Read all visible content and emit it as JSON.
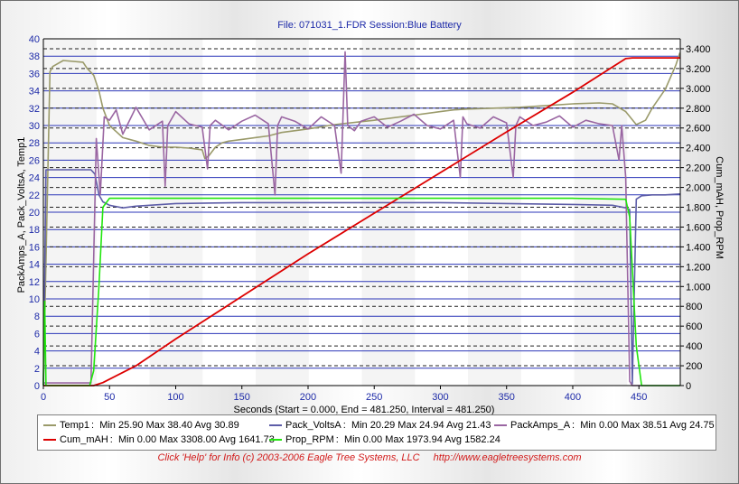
{
  "title": "File: 071031_1.FDR   Session:Blue Battery",
  "footer": {
    "help": "Click 'Help' for Info  (c) 2003-2006 Eagle Tree Systems, LLC",
    "url": "http://www.eagletreesystems.com"
  },
  "chart_data": {
    "type": "line",
    "xlabel": "Seconds (Start = 0.000,  End = 481.250,  Interval =  481.250)",
    "ylabel_left": "PackAmps_A, Pack_VoltsA, Temp1",
    "ylabel_right": "Cum_mAH, Prop_RPM",
    "xlim": [
      0,
      481.25
    ],
    "ylim_left": [
      0,
      40
    ],
    "ylim_right": [
      0,
      3500
    ],
    "xticks": [
      0,
      50,
      100,
      150,
      200,
      250,
      300,
      350,
      400,
      450
    ],
    "yticks_left": [
      0,
      2,
      4,
      6,
      8,
      10,
      12,
      14,
      16,
      18,
      20,
      22,
      24,
      26,
      28,
      30,
      32,
      34,
      36,
      38,
      40
    ],
    "yticks_right": [
      "0",
      "200",
      "400",
      "600",
      "800",
      "1.000",
      "1.200",
      "1.400",
      "1.600",
      "1.800",
      "2.000",
      "2.200",
      "2.400",
      "2.600",
      "2.800",
      "3.000",
      "3.200",
      "3.400"
    ],
    "yticks_right_values": [
      0,
      200,
      400,
      600,
      800,
      1000,
      1200,
      1400,
      1600,
      1800,
      2000,
      2200,
      2400,
      2600,
      2800,
      3000,
      3200,
      3400
    ],
    "grid": true,
    "legend_position": "bottom",
    "series": [
      {
        "name": "Temp1",
        "axis": "left",
        "color": "#9a9a6a",
        "stats": "Min 25.90 Max 38.40 Avg 30.89",
        "x": [
          0,
          5,
          7,
          15,
          30,
          33,
          38,
          42,
          45,
          50,
          55,
          60,
          70,
          80,
          90,
          100,
          110,
          120,
          122,
          125,
          130,
          135,
          140,
          150,
          160,
          170,
          180,
          200,
          220,
          250,
          280,
          300,
          310,
          320,
          340,
          360,
          380,
          400,
          420,
          430,
          440,
          448,
          455,
          460,
          470,
          478,
          481
        ],
        "y": [
          0,
          36.2,
          36.8,
          37.5,
          37.3,
          36.6,
          35.8,
          34,
          32,
          30,
          29.3,
          28.6,
          28.2,
          27.7,
          27.5,
          27.5,
          27.4,
          27.2,
          26.2,
          26.5,
          27.5,
          28.0,
          28.2,
          28.4,
          28.6,
          28.8,
          29.2,
          29.6,
          30.1,
          30.6,
          31.2,
          31.6,
          31.8,
          31.9,
          32.0,
          32.1,
          32.3,
          32.5,
          32.6,
          32.5,
          31.6,
          30.1,
          30.6,
          32.0,
          34.2,
          37.0,
          38.4
        ]
      },
      {
        "name": "Pack_VoltsA",
        "axis": "left",
        "color": "#5d5da8",
        "stats": "Min 20.29 Max 24.94 Avg 21.43",
        "x": [
          0,
          2,
          36,
          39,
          42,
          45,
          50,
          60,
          70,
          100,
          150,
          200,
          250,
          300,
          350,
          400,
          430,
          440,
          443,
          445,
          448,
          452,
          460,
          470,
          481
        ],
        "y": [
          0,
          24.9,
          24.9,
          24.4,
          22.0,
          21.2,
          20.8,
          20.5,
          20.7,
          21.0,
          21.1,
          21.1,
          21.1,
          21.1,
          21.0,
          20.9,
          20.8,
          20.5,
          20.3,
          0.2,
          21.5,
          21.9,
          22.0,
          22.0,
          22.1
        ]
      },
      {
        "name": "PackAmps_A",
        "axis": "left",
        "color": "#9a66a2",
        "stats": "Min 0.00 Max 38.51 Avg 24.75",
        "x": [
          0,
          36,
          40,
          43,
          46,
          50,
          55,
          60,
          70,
          80,
          90,
          92,
          94,
          100,
          110,
          120,
          124,
          126,
          130,
          140,
          150,
          160,
          170,
          175,
          177,
          180,
          190,
          200,
          210,
          220,
          225,
          228,
          230,
          235,
          240,
          250,
          260,
          270,
          280,
          290,
          300,
          310,
          315,
          317,
          320,
          330,
          340,
          350,
          355,
          357,
          360,
          370,
          380,
          390,
          400,
          410,
          420,
          430,
          435,
          437,
          440,
          443,
          445,
          481
        ],
        "y": [
          0.3,
          0.3,
          28.5,
          22.0,
          31.0,
          30.6,
          31.8,
          29.0,
          32.1,
          29.5,
          30.5,
          23.0,
          30.0,
          31.6,
          30.2,
          29.8,
          25.0,
          30.0,
          30.6,
          29.5,
          30.5,
          31.2,
          30.2,
          22.0,
          30.0,
          31.0,
          30.5,
          29.6,
          31.0,
          30.0,
          24.5,
          38.5,
          30.0,
          29.4,
          30.5,
          31.0,
          29.8,
          30.5,
          31.3,
          30.0,
          29.6,
          30.6,
          24.0,
          31.0,
          30.2,
          29.7,
          31.0,
          30.3,
          24.0,
          30.0,
          31.0,
          30.0,
          30.4,
          31.1,
          29.8,
          30.6,
          30.2,
          30.0,
          26.0,
          30.0,
          24.0,
          0.5,
          0,
          0
        ]
      },
      {
        "name": "Cum_mAH",
        "axis": "right",
        "color": "#dd0000",
        "stats": "Min 0.00 Max 3308.00 Avg 1641.73",
        "x": [
          0,
          38,
          45,
          70,
          100,
          150,
          200,
          250,
          300,
          350,
          400,
          440,
          445,
          481
        ],
        "y": [
          0,
          0,
          30,
          200,
          470,
          900,
          1330,
          1740,
          2150,
          2560,
          2960,
          3300,
          3308,
          3308
        ]
      },
      {
        "name": "Prop_RPM",
        "axis": "right",
        "color": "#22e60e",
        "stats": "Min 0.00 Max 1973.94 Avg 1582.24",
        "x": [
          0,
          1,
          2,
          3,
          35,
          38,
          42,
          45,
          50,
          100,
          150,
          200,
          250,
          300,
          350,
          400,
          440,
          443,
          448,
          452,
          481
        ],
        "y": [
          0,
          850,
          0,
          0,
          0,
          150,
          1000,
          1800,
          1890,
          1890,
          1890,
          1890,
          1890,
          1890,
          1890,
          1890,
          1880,
          1700,
          400,
          0,
          0
        ]
      }
    ]
  }
}
